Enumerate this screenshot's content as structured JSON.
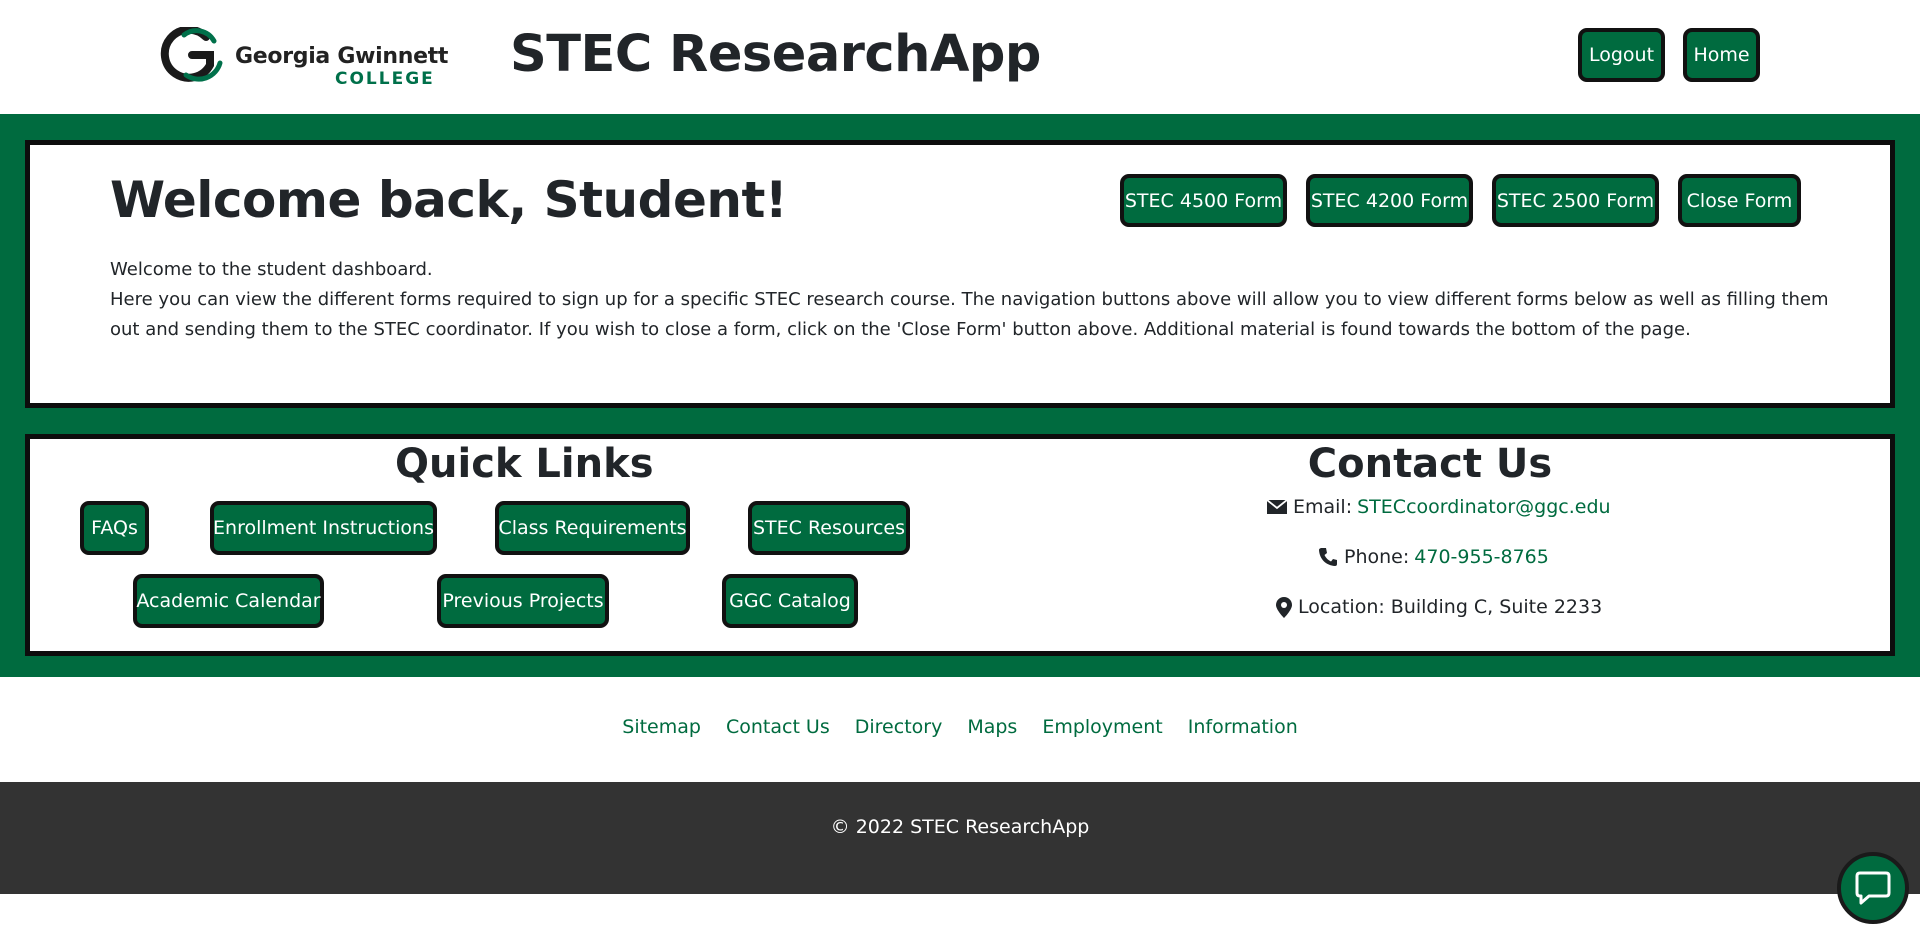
{
  "header": {
    "logo": {
      "line1": "Georgia Gwinnett",
      "line2": "COLLEGE"
    },
    "app_title": "STEC ResearchApp",
    "logout_label": "Logout",
    "home_label": "Home"
  },
  "welcome": {
    "title": "Welcome back, Student!",
    "forms": [
      {
        "label": "STEC 4500 Form"
      },
      {
        "label": "STEC 4200 Form"
      },
      {
        "label": "STEC 2500 Form"
      },
      {
        "label": "Close Form"
      }
    ],
    "line1": "Welcome to the student dashboard.",
    "line2": "Here you can view the different forms required to sign up for a specific STEC research course. The navigation buttons above will allow you to view different forms below as well as filling them out and sending them to the STEC coordinator. If you wish to close a form, click on the 'Close Form' button above. Additional material is found towards the bottom of the page."
  },
  "quick_links": {
    "title": "Quick Links",
    "items": [
      {
        "label": "FAQs"
      },
      {
        "label": "Enrollment Instructions"
      },
      {
        "label": "Class Requirements"
      },
      {
        "label": "STEC Resources"
      },
      {
        "label": "Academic Calendar"
      },
      {
        "label": "Previous Projects"
      },
      {
        "label": "GGC Catalog"
      }
    ]
  },
  "contact": {
    "title": "Contact Us",
    "email_label": "Email:",
    "email_value": "STECcoordinator@ggc.edu",
    "phone_label": "Phone:",
    "phone_value": "470-955-8765",
    "location": "Location: Building C, Suite 2233"
  },
  "footer": {
    "links": [
      {
        "label": "Sitemap"
      },
      {
        "label": "Contact Us"
      },
      {
        "label": "Directory"
      },
      {
        "label": "Maps"
      },
      {
        "label": "Employment"
      },
      {
        "label": "Information"
      }
    ],
    "copyright": "© 2022 STEC ResearchApp"
  },
  "colors": {
    "brand_green": "#006b3f",
    "footer_dark": "#333333",
    "border_dark": "#0d0d0d"
  },
  "icons": [
    "ggc-logo-icon",
    "envelope-icon",
    "phone-icon",
    "map-pin-icon",
    "chat-icon"
  ]
}
